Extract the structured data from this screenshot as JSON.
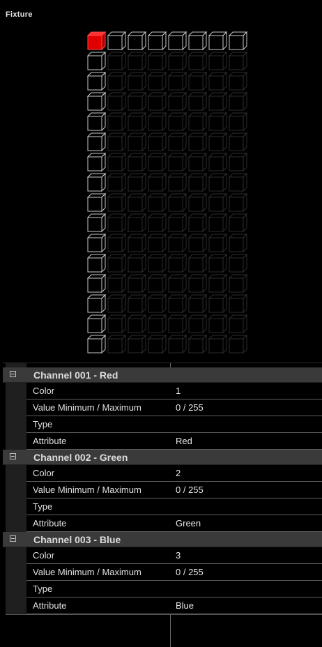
{
  "panel": {
    "title": "Fixture"
  },
  "fixture_grid": {
    "columns": 8,
    "rows": 16,
    "selected_cell": {
      "row": 1,
      "column": 1
    },
    "selected_color": "#e00000"
  },
  "channels": [
    {
      "header": "Channel 001 - Red",
      "properties": [
        {
          "name": "Color",
          "value": "1"
        },
        {
          "name": "Value Minimum / Maximum",
          "value": "0  /  255"
        },
        {
          "name": "Type",
          "value": ""
        },
        {
          "name": "Attribute",
          "value": "Red"
        }
      ]
    },
    {
      "header": "Channel 002 - Green",
      "properties": [
        {
          "name": "Color",
          "value": "2"
        },
        {
          "name": "Value Minimum / Maximum",
          "value": "0  /  255"
        },
        {
          "name": "Type",
          "value": ""
        },
        {
          "name": "Attribute",
          "value": "Green"
        }
      ]
    },
    {
      "header": "Channel 003 - Blue",
      "properties": [
        {
          "name": "Color",
          "value": "3"
        },
        {
          "name": "Value Minimum / Maximum",
          "value": "0  /  255"
        },
        {
          "name": "Type",
          "value": ""
        },
        {
          "name": "Attribute",
          "value": "Blue"
        }
      ]
    }
  ]
}
